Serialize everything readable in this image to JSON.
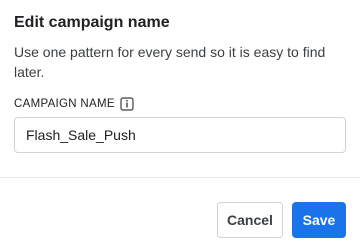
{
  "dialog": {
    "title": "Edit campaign name",
    "description": "Use one pattern for every send so it is easy to find later."
  },
  "field": {
    "label": "CAMPAIGN NAME",
    "info_icon": "info-icon",
    "value": "Flash_Sale_Push",
    "placeholder": ""
  },
  "actions": {
    "cancel_label": "Cancel",
    "save_label": "Save"
  },
  "colors": {
    "primary": "#1a73e8",
    "text": "#202124",
    "border": "#d0d4d9"
  }
}
